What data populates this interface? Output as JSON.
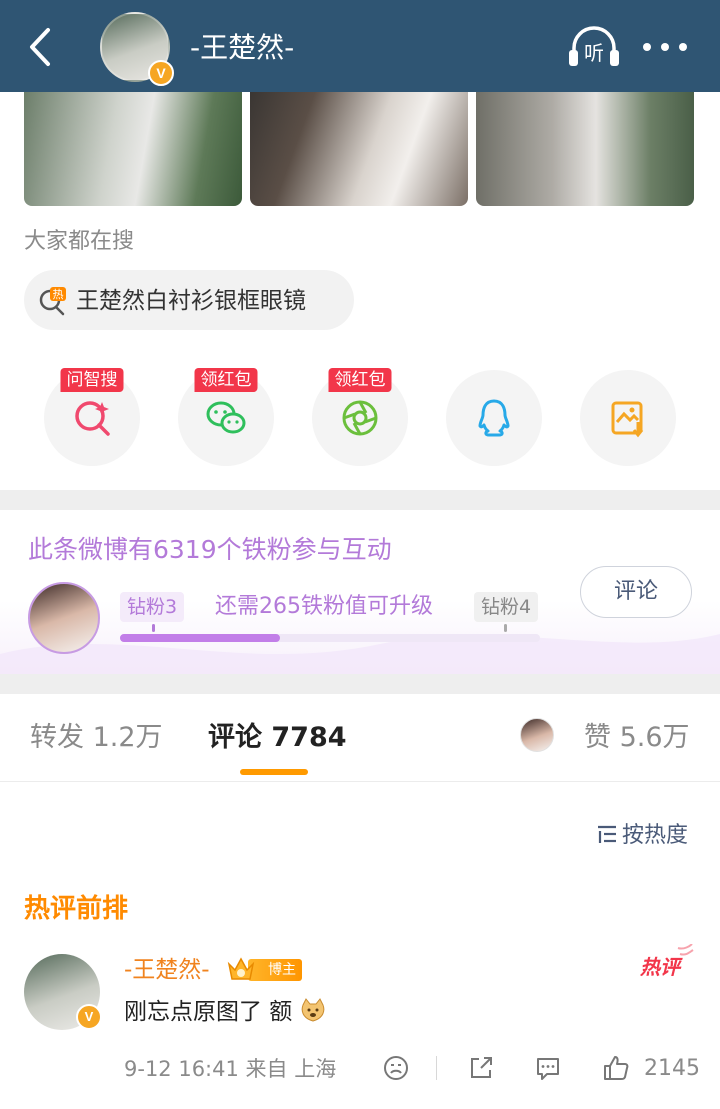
{
  "header": {
    "title": "-王楚然-",
    "verified_badge": "V",
    "listen_label": "听"
  },
  "search": {
    "heading": "大家都在搜",
    "chip_badge": "热",
    "chip_text": "王楚然白衬衫银框眼镜"
  },
  "share_row": [
    {
      "icon": "ai-search-icon",
      "tag": "问智搜"
    },
    {
      "icon": "wechat-icon",
      "tag": "领红包"
    },
    {
      "icon": "moments-icon",
      "tag": "领红包"
    },
    {
      "icon": "qq-icon",
      "tag": ""
    },
    {
      "icon": "save-image-icon",
      "tag": ""
    }
  ],
  "fan": {
    "title": "此条微博有6319个铁粉参与互动",
    "current_level": "钻粉3",
    "need_text": "还需265铁粉值可升级",
    "next_level": "钻粉4",
    "progress_fraction": 0.38,
    "comment_button": "评论"
  },
  "tabs": {
    "forward": "转发 1.2万",
    "comment": "评论 7784",
    "like": "赞 5.6万"
  },
  "sort_label": "按热度",
  "hot_section_title": "热评前排",
  "comment": {
    "author": "-王楚然-",
    "author_badge": "博主",
    "hot_stamp": "热评",
    "text": "刚忘点原图了 额",
    "meta": "9-12 16:41 来自 上海",
    "like_count": "2145"
  },
  "colors": {
    "header_bg": "#2f5573",
    "accent_orange": "#ff9a00",
    "fan_purple": "#b37ad9",
    "tag_red": "#f2364a"
  }
}
